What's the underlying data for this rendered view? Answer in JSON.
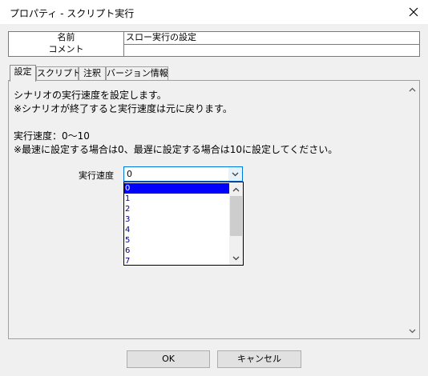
{
  "window": {
    "title": "プロパティ - スクリプト実行"
  },
  "properties": {
    "name_label": "名前",
    "name_value": "スロー実行の設定",
    "comment_label": "コメント",
    "comment_value": ""
  },
  "tabs": [
    "設定",
    "スクリプト",
    "注釈",
    "バージョン情報"
  ],
  "content": {
    "line1": "シナリオの実行速度を設定します。",
    "line2": "※シナリオが終了すると実行速度は元に戻ります。",
    "line3": "実行速度：0～10",
    "line4": "※最速に設定する場合は0、最遅に設定する場合は10に設定してください。"
  },
  "speed": {
    "label": "実行速度",
    "value": "0",
    "options": [
      "0",
      "1",
      "2",
      "3",
      "4",
      "5",
      "6",
      "7"
    ]
  },
  "buttons": {
    "ok": "OK",
    "cancel": "キャンセル"
  }
}
